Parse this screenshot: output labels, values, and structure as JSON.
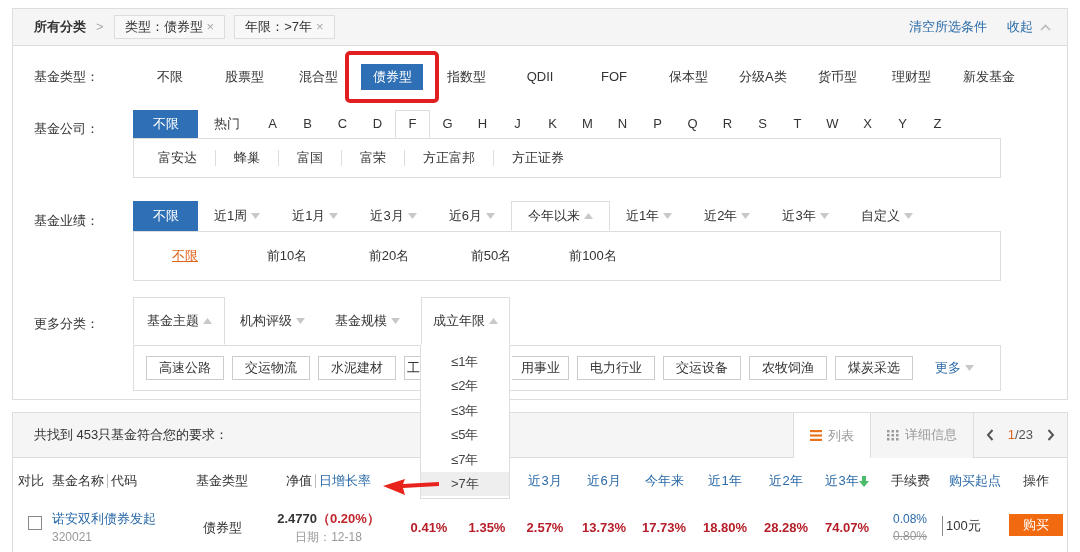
{
  "breadcrumb": {
    "root": "所有分类",
    "separator": ">",
    "filters": [
      {
        "label": "类型：债券型",
        "remove": "×"
      },
      {
        "label": "年限：>7年",
        "remove": "×"
      }
    ],
    "clear": "清空所选条件",
    "collapse": "收起"
  },
  "fund_type": {
    "label": "基金类型：",
    "options": [
      {
        "label": "不限",
        "selected": false,
        "highlighted": false
      },
      {
        "label": "股票型",
        "selected": false,
        "highlighted": false
      },
      {
        "label": "混合型",
        "selected": false,
        "highlighted": false
      },
      {
        "label": "债券型",
        "selected": true,
        "highlighted": true
      },
      {
        "label": "指数型",
        "selected": false,
        "highlighted": false
      },
      {
        "label": "QDII",
        "selected": false,
        "highlighted": false
      },
      {
        "label": "FOF",
        "selected": false,
        "highlighted": false
      },
      {
        "label": "保本型",
        "selected": false,
        "highlighted": false
      },
      {
        "label": "分级A类",
        "selected": false,
        "highlighted": false
      },
      {
        "label": "货币型",
        "selected": false,
        "highlighted": false
      },
      {
        "label": "理财型",
        "selected": false,
        "highlighted": false
      },
      {
        "label": "新发基金",
        "selected": false,
        "highlighted": false
      }
    ]
  },
  "company": {
    "label": "基金公司：",
    "tabs": [
      {
        "label": "不限",
        "kind": "wide",
        "selected": true,
        "open": false
      },
      {
        "label": "热门",
        "kind": "text",
        "selected": false,
        "open": false
      },
      {
        "label": "A",
        "kind": "letter",
        "selected": false,
        "open": false
      },
      {
        "label": "B",
        "kind": "letter",
        "selected": false,
        "open": false
      },
      {
        "label": "C",
        "kind": "letter",
        "selected": false,
        "open": false
      },
      {
        "label": "D",
        "kind": "letter",
        "selected": false,
        "open": false
      },
      {
        "label": "F",
        "kind": "letter",
        "selected": false,
        "open": true
      },
      {
        "label": "G",
        "kind": "letter",
        "selected": false,
        "open": false
      },
      {
        "label": "H",
        "kind": "letter",
        "selected": false,
        "open": false
      },
      {
        "label": "J",
        "kind": "letter",
        "selected": false,
        "open": false
      },
      {
        "label": "K",
        "kind": "letter",
        "selected": false,
        "open": false
      },
      {
        "label": "M",
        "kind": "letter",
        "selected": false,
        "open": false
      },
      {
        "label": "N",
        "kind": "letter",
        "selected": false,
        "open": false
      },
      {
        "label": "P",
        "kind": "letter",
        "selected": false,
        "open": false
      },
      {
        "label": "Q",
        "kind": "letter",
        "selected": false,
        "open": false
      },
      {
        "label": "R",
        "kind": "letter",
        "selected": false,
        "open": false
      },
      {
        "label": "S",
        "kind": "letter",
        "selected": false,
        "open": false
      },
      {
        "label": "T",
        "kind": "letter",
        "selected": false,
        "open": false
      },
      {
        "label": "W",
        "kind": "letter",
        "selected": false,
        "open": false
      },
      {
        "label": "X",
        "kind": "letter",
        "selected": false,
        "open": false
      },
      {
        "label": "Y",
        "kind": "letter",
        "selected": false,
        "open": false
      },
      {
        "label": "Z",
        "kind": "letter",
        "selected": false,
        "open": false
      }
    ],
    "companies": [
      "富安达",
      "蜂巢",
      "富国",
      "富荣",
      "方正富邦",
      "方正证券"
    ]
  },
  "performance": {
    "label": "基金业绩：",
    "tabs": [
      {
        "label": "不限",
        "caret": false,
        "selected": true,
        "open": false
      },
      {
        "label": "近1周",
        "caret": true,
        "selected": false,
        "open": false
      },
      {
        "label": "近1月",
        "caret": true,
        "selected": false,
        "open": false
      },
      {
        "label": "近3月",
        "caret": true,
        "selected": false,
        "open": false
      },
      {
        "label": "近6月",
        "caret": true,
        "selected": false,
        "open": false
      },
      {
        "label": "今年以来",
        "caret": true,
        "selected": false,
        "open": true
      },
      {
        "label": "近1年",
        "caret": true,
        "selected": false,
        "open": false
      },
      {
        "label": "近2年",
        "caret": true,
        "selected": false,
        "open": false
      },
      {
        "label": "近3年",
        "caret": true,
        "selected": false,
        "open": false
      },
      {
        "label": "自定义",
        "caret": true,
        "selected": false,
        "open": false
      }
    ],
    "ranks": [
      {
        "label": "不限",
        "selected": true
      },
      {
        "label": "前10名",
        "selected": false
      },
      {
        "label": "前20名",
        "selected": false
      },
      {
        "label": "前50名",
        "selected": false
      },
      {
        "label": "前100名",
        "selected": false
      }
    ]
  },
  "more": {
    "label": "更多分类：",
    "tabs": [
      {
        "label": "基金主题",
        "caret": true,
        "open": true,
        "dropdown": false
      },
      {
        "label": "机构评级",
        "caret": true,
        "open": false,
        "dropdown": false
      },
      {
        "label": "基金规模",
        "caret": true,
        "open": false,
        "dropdown": false
      },
      {
        "label": "成立年限",
        "caret": true,
        "open": true,
        "dropdown": true
      }
    ],
    "themes": [
      {
        "label": "高速公路",
        "kind": "full"
      },
      {
        "label": "交运物流",
        "kind": "full"
      },
      {
        "label": "水泥建材",
        "kind": "full"
      },
      {
        "label": "工",
        "kind": "cut_end"
      },
      {
        "label": "用事业",
        "kind": "cut_start"
      },
      {
        "label": "电力行业",
        "kind": "full"
      },
      {
        "label": "交运设备",
        "kind": "full"
      },
      {
        "label": "农牧饲渔",
        "kind": "full"
      },
      {
        "label": "煤炭采选",
        "kind": "full"
      }
    ],
    "more_link": "更多"
  },
  "age_dropdown": {
    "options": [
      {
        "label": "≤1年",
        "selected": false
      },
      {
        "label": "≤2年",
        "selected": false
      },
      {
        "label": "≤3年",
        "selected": false
      },
      {
        "label": "≤5年",
        "selected": false
      },
      {
        "label": "≤7年",
        "selected": false
      },
      {
        "label": ">7年",
        "selected": true
      }
    ]
  },
  "results": {
    "summary": "共找到 453只基金符合您的要求：",
    "views": [
      {
        "label": "列表",
        "kind": "list",
        "selected": true
      },
      {
        "label": "详细信息",
        "kind": "detail",
        "selected": false
      }
    ],
    "page": {
      "current": "1",
      "total": "/23"
    },
    "columns": [
      {
        "parts": [
          {
            "text": "对比",
            "kind": "plain"
          }
        ]
      },
      {
        "parts": [
          {
            "text": "基金名称",
            "kind": "plain"
          },
          {
            "text": "代码",
            "kind": "plain"
          }
        ]
      },
      {
        "parts": [
          {
            "text": "基金类型",
            "kind": "plain"
          }
        ]
      },
      {
        "parts": [
          {
            "text": "净值",
            "kind": "plain"
          },
          {
            "text": "日增长率",
            "kind": "link"
          }
        ]
      },
      {},
      {},
      {
        "parts": [
          {
            "text": "近3月",
            "kind": "link"
          }
        ]
      },
      {
        "parts": [
          {
            "text": "近6月",
            "kind": "link"
          }
        ]
      },
      {
        "parts": [
          {
            "text": "今年来",
            "kind": "link"
          }
        ]
      },
      {
        "parts": [
          {
            "text": "近1年",
            "kind": "link"
          }
        ]
      },
      {
        "parts": [
          {
            "text": "近2年",
            "kind": "link"
          }
        ]
      },
      {
        "parts": [
          {
            "text": "近3年",
            "kind": "link"
          }
        ],
        "sorted": true
      },
      {
        "parts": [
          {
            "text": "手续费",
            "kind": "plain"
          }
        ]
      },
      {
        "parts": [
          {
            "text": "购买起点",
            "kind": "link"
          }
        ]
      },
      {
        "parts": [
          {
            "text": "操作",
            "kind": "plain"
          }
        ]
      }
    ],
    "rows": [
      {
        "checked": false,
        "name": "诺安双利债券发起",
        "code": "320021",
        "type": "债券型",
        "nav": "2.4770",
        "daily": "（0.20%）",
        "date": "日期：12-18",
        "returns": [
          "0.41%",
          "1.35%",
          "2.57%",
          "13.73%",
          "17.73%",
          "18.80%",
          "28.28%",
          "74.07%"
        ],
        "fee": "0.08%",
        "fee_original": "0.80%",
        "min_buy": "100元",
        "action": "购买"
      }
    ]
  }
}
